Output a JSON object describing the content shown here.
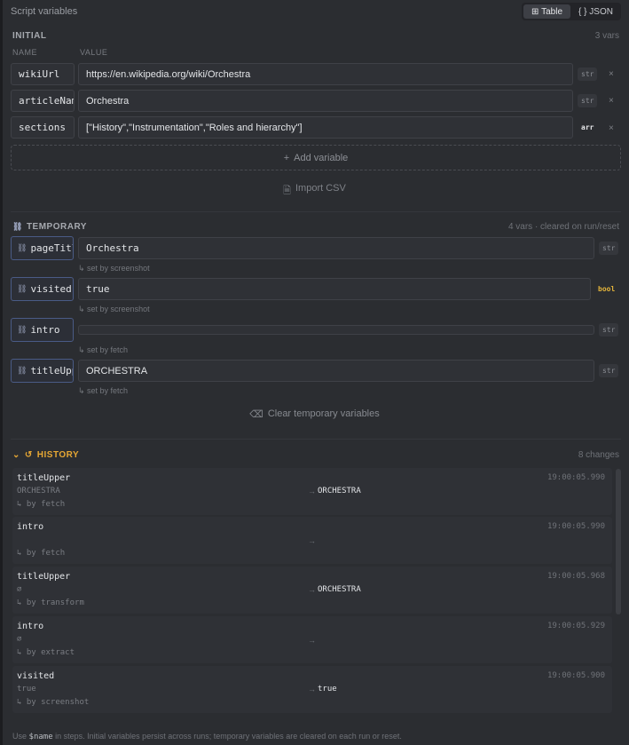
{
  "header": {
    "title": "Script variables",
    "view_toggle": [
      {
        "label": "Table",
        "icon": "table-icon",
        "active": true
      },
      {
        "label": "JSON",
        "icon": "braces-icon",
        "active": false
      }
    ]
  },
  "initial": {
    "title": "INITIAL",
    "count": "3 vars",
    "columns": {
      "name": "NAME",
      "value": "VALUE"
    },
    "vars": [
      {
        "name": "wikiUrl",
        "value": "https://en.wikipedia.org/wiki/Orchestra",
        "type": "str",
        "remove": "×"
      },
      {
        "name": "articleName",
        "value": "Orchestra",
        "type": "str",
        "remove": "×"
      },
      {
        "name": "sections",
        "value": "[\"History\",\"Instrumentation\",\"Roles and hierarchy\"]",
        "type": "arr",
        "remove": "×"
      }
    ],
    "add_label": "Add variable",
    "import_label": "Import CSV"
  },
  "temporary": {
    "title": "TEMPORARY",
    "subtitle": "4 vars · cleared on run/reset",
    "vars": [
      {
        "name": "pageTitle",
        "value": "Orchestra",
        "type": "str",
        "set_by": "↳ set by screenshot"
      },
      {
        "name": "visited",
        "value": "true",
        "type": "bool",
        "set_by": "↳ set by screenshot"
      },
      {
        "name": "intro",
        "value": "",
        "type": "str",
        "set_by": "↳ set by fetch"
      },
      {
        "name": "titleUpper",
        "value": "ORCHESTRA",
        "type": "str",
        "set_by": "↳ set by fetch"
      }
    ],
    "clear_label": "Clear temporary variables"
  },
  "history": {
    "title": "HISTORY",
    "count": "8 changes",
    "entries": [
      {
        "name": "titleUpper",
        "old": "ORCHESTRA",
        "arrow": "→",
        "new": "ORCHESTRA",
        "by": "↳ by fetch",
        "time": "19:00:05.990"
      },
      {
        "name": "intro",
        "old": "",
        "arrow": "→",
        "new": "",
        "by": "↳ by fetch",
        "time": "19:00:05.990"
      },
      {
        "name": "titleUpper",
        "old": "∅",
        "arrow": "→",
        "new": "ORCHESTRA",
        "by": "↳ by transform",
        "time": "19:00:05.968"
      },
      {
        "name": "intro",
        "old": "∅",
        "arrow": "→",
        "new": "",
        "by": "↳ by extract",
        "time": "19:00:05.929"
      },
      {
        "name": "visited",
        "old": "true",
        "arrow": "→",
        "new": "true",
        "by": "↳ by screenshot",
        "time": "19:00:05.900"
      }
    ]
  },
  "footer": {
    "prefix": "Use",
    "code": "$name",
    "suffix": "in steps. Initial variables persist across runs; temporary variables are cleared on each run or reset."
  },
  "colors": {
    "background": "#2b2d31",
    "history_accent": "#e6a734",
    "bool_badge": "#e5b53b",
    "temp_border": "#4a5b86"
  }
}
